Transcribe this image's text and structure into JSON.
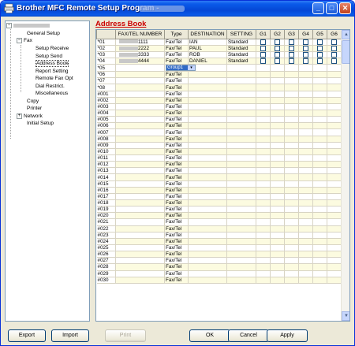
{
  "window": {
    "title": "Brother MFC Remote Setup Program -",
    "buttons": {
      "minimize": "_",
      "maximize": "□",
      "close": "✕"
    }
  },
  "tree": {
    "items": [
      {
        "label": "General Setup"
      },
      {
        "label": "Fax",
        "expander": "−"
      },
      {
        "label": "Setup Receive"
      },
      {
        "label": "Setup Send"
      },
      {
        "label": "Address Book"
      },
      {
        "label": "Report Setting"
      },
      {
        "label": "Remote Fax Opt"
      },
      {
        "label": "Dial Restrict."
      },
      {
        "label": "Miscellaneous"
      },
      {
        "label": "Copy"
      },
      {
        "label": "Printer"
      },
      {
        "label": "Network",
        "expander": "+"
      },
      {
        "label": "Initial Setup"
      }
    ]
  },
  "page_title": "Address Book",
  "table": {
    "headers": [
      "FAX/TEL NUMBER",
      "Type",
      "DESTINATION",
      "SETTING",
      "G1",
      "G2",
      "G3",
      "G4",
      "G5",
      "G6"
    ],
    "default_type": "Fax/Tel",
    "default_setting": "Standard",
    "group_dropdown": {
      "value": "Group1",
      "arrow": "▾"
    },
    "rows": [
      {
        "index": "*01",
        "number": "1111",
        "type": "Fax/Tel",
        "destination": "IAN",
        "setting": "Standard"
      },
      {
        "index": "*02",
        "number": "2222",
        "type": "Fax/Tel",
        "destination": "PAUL",
        "setting": "Standard"
      },
      {
        "index": "*03",
        "number": "3333",
        "type": "Fax/Tel",
        "destination": "ROB",
        "setting": "Standard"
      },
      {
        "index": "*04",
        "number": "4444",
        "type": "Fax/Tel",
        "destination": "DANIEL",
        "setting": "Standard"
      },
      {
        "index": "*05",
        "number": "",
        "type": "",
        "destination": "",
        "setting": "",
        "dropdown": true
      },
      {
        "index": "*06",
        "number": "",
        "type": "Fax/Tel",
        "destination": "",
        "setting": ""
      },
      {
        "index": "*07",
        "number": "",
        "type": "Fax/Tel",
        "destination": "",
        "setting": ""
      },
      {
        "index": "*08",
        "number": "",
        "type": "Fax/Tel",
        "destination": "",
        "setting": ""
      },
      {
        "index": "#001",
        "number": "",
        "type": "Fax/Tel",
        "destination": "",
        "setting": ""
      },
      {
        "index": "#002",
        "number": "",
        "type": "Fax/Tel",
        "destination": "",
        "setting": ""
      },
      {
        "index": "#003",
        "number": "",
        "type": "Fax/Tel",
        "destination": "",
        "setting": ""
      },
      {
        "index": "#004",
        "number": "",
        "type": "Fax/Tel",
        "destination": "",
        "setting": ""
      },
      {
        "index": "#005",
        "number": "",
        "type": "Fax/Tel",
        "destination": "",
        "setting": ""
      },
      {
        "index": "#006",
        "number": "",
        "type": "Fax/Tel",
        "destination": "",
        "setting": ""
      },
      {
        "index": "#007",
        "number": "",
        "type": "Fax/Tel",
        "destination": "",
        "setting": ""
      },
      {
        "index": "#008",
        "number": "",
        "type": "Fax/Tel",
        "destination": "",
        "setting": ""
      },
      {
        "index": "#009",
        "number": "",
        "type": "Fax/Tel",
        "destination": "",
        "setting": ""
      },
      {
        "index": "#010",
        "number": "",
        "type": "Fax/Tel",
        "destination": "",
        "setting": ""
      },
      {
        "index": "#011",
        "number": "",
        "type": "Fax/Tel",
        "destination": "",
        "setting": ""
      },
      {
        "index": "#012",
        "number": "",
        "type": "Fax/Tel",
        "destination": "",
        "setting": ""
      },
      {
        "index": "#013",
        "number": "",
        "type": "Fax/Tel",
        "destination": "",
        "setting": ""
      },
      {
        "index": "#014",
        "number": "",
        "type": "Fax/Tel",
        "destination": "",
        "setting": ""
      },
      {
        "index": "#015",
        "number": "",
        "type": "Fax/Tel",
        "destination": "",
        "setting": ""
      },
      {
        "index": "#016",
        "number": "",
        "type": "Fax/Tel",
        "destination": "",
        "setting": ""
      },
      {
        "index": "#017",
        "number": "",
        "type": "Fax/Tel",
        "destination": "",
        "setting": ""
      },
      {
        "index": "#018",
        "number": "",
        "type": "Fax/Tel",
        "destination": "",
        "setting": ""
      },
      {
        "index": "#019",
        "number": "",
        "type": "Fax/Tel",
        "destination": "",
        "setting": ""
      },
      {
        "index": "#020",
        "number": "",
        "type": "Fax/Tel",
        "destination": "",
        "setting": ""
      },
      {
        "index": "#021",
        "number": "",
        "type": "Fax/Tel",
        "destination": "",
        "setting": ""
      },
      {
        "index": "#022",
        "number": "",
        "type": "Fax/Tel",
        "destination": "",
        "setting": ""
      },
      {
        "index": "#023",
        "number": "",
        "type": "Fax/Tel",
        "destination": "",
        "setting": ""
      },
      {
        "index": "#024",
        "number": "",
        "type": "Fax/Tel",
        "destination": "",
        "setting": ""
      },
      {
        "index": "#025",
        "number": "",
        "type": "Fax/Tel",
        "destination": "",
        "setting": ""
      },
      {
        "index": "#026",
        "number": "",
        "type": "Fax/Tel",
        "destination": "",
        "setting": ""
      },
      {
        "index": "#027",
        "number": "",
        "type": "Fax/Tel",
        "destination": "",
        "setting": ""
      },
      {
        "index": "#028",
        "number": "",
        "type": "Fax/Tel",
        "destination": "",
        "setting": ""
      },
      {
        "index": "#029",
        "number": "",
        "type": "Fax/Tel",
        "destination": "",
        "setting": ""
      },
      {
        "index": "#030",
        "number": "",
        "type": "Fax/Tel",
        "destination": "",
        "setting": ""
      }
    ],
    "scroll_up": "▲",
    "scroll_down": "▼"
  },
  "footer": {
    "export": "Export",
    "import": "Import",
    "print": "Print",
    "ok": "OK",
    "cancel": "Cancel",
    "apply": "Apply"
  },
  "colors": {
    "title_bar": "#0a5ae9",
    "page_title": "#cc0000",
    "row_highlight": "#fcfbe0",
    "selection": "#316ac5"
  }
}
